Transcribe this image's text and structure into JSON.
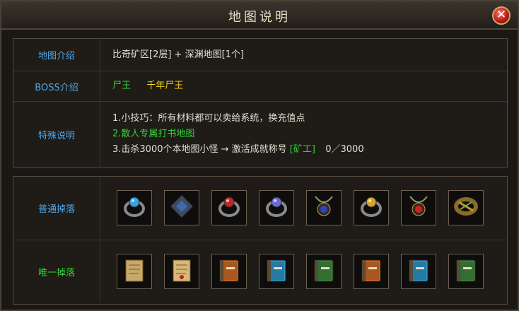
{
  "window": {
    "title": "地图说明",
    "close_glyph": "✕"
  },
  "info": {
    "map_label": "地图介绍",
    "map_value": "比奇矿区[2层] + 深渊地图[1个]",
    "boss_label": "BOSS介绍",
    "boss_list": [
      "尸王",
      "千年尸王"
    ],
    "special_label": "特殊说明",
    "special_lines": [
      "1.小技巧：所有材料都可以卖给系统，换充值点",
      "2.散人专属打书地图"
    ],
    "line3": {
      "prefix": "3.击杀3000个本地图小怪 → 激活成就称号",
      "title": "[矿工]",
      "progress": "0／3000"
    }
  },
  "drops": {
    "normal_label": "普通掉落",
    "unique_label": "唯一掉落",
    "normal_items": [
      {
        "icon": "ring-icon",
        "color": "#3aa0e0"
      },
      {
        "icon": "rune-stone-icon",
        "color": "#3a6ab0"
      },
      {
        "icon": "skull-ring-icon",
        "color": "#c02828"
      },
      {
        "icon": "silver-ring-icon",
        "color": "#6a6ad0"
      },
      {
        "icon": "sapphire-amulet-icon",
        "color": "#2a46c8"
      },
      {
        "icon": "gold-ring-icon",
        "color": "#d8a428"
      },
      {
        "icon": "ruby-necklace-icon",
        "color": "#d02020"
      },
      {
        "icon": "bracelet-icon",
        "color": "#c89a28"
      }
    ],
    "unique_items": [
      {
        "icon": "scroll-icon",
        "color": "#c8a868"
      },
      {
        "icon": "parchment-icon",
        "color": "#d8b878"
      },
      {
        "icon": "orange-skill-book-icon",
        "color": "#d86a20"
      },
      {
        "icon": "blue-skill-book-icon",
        "color": "#2a9ad0"
      },
      {
        "icon": "green-skill-book-icon",
        "color": "#3a8a3a"
      },
      {
        "icon": "orange-skill-book-icon",
        "color": "#d86a20"
      },
      {
        "icon": "blue-skill-book-icon",
        "color": "#2a9ad0"
      },
      {
        "icon": "green-skill-book-icon",
        "color": "#3a8a3a"
      }
    ]
  },
  "colors": {
    "label_blue": "#4fa8ea",
    "green": "#34d23a",
    "yellow": "#f0d21a"
  }
}
